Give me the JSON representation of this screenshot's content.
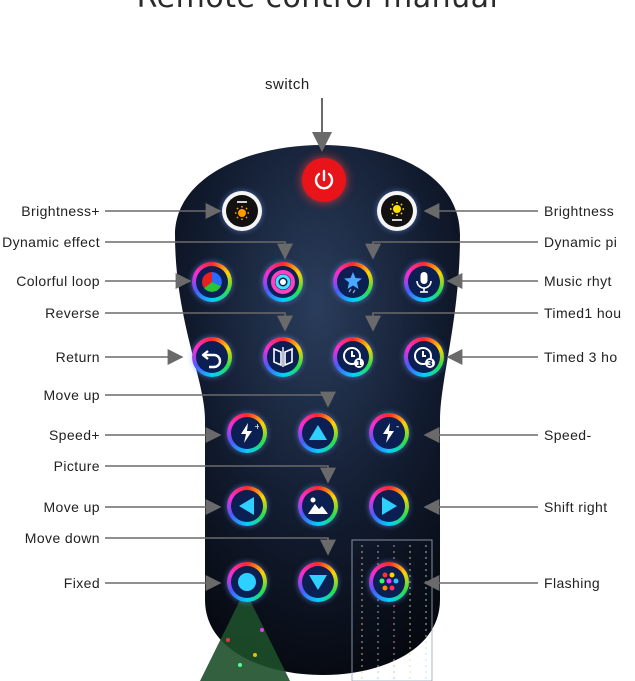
{
  "title": "Remote control manual",
  "switch_label": "switch",
  "left_labels": [
    "Brightness+",
    "Dynamic effect",
    "Colorful loop",
    "Reverse",
    "Return",
    "Move up",
    "Speed+",
    "Picture",
    "Move up",
    "Move down",
    "Fixed"
  ],
  "right_labels": [
    "Brightness",
    "Dynamic pi",
    "Music rhyt",
    "Timed1 hou",
    "Timed 3 ho",
    "Speed-",
    "Shift right",
    "Flashing"
  ],
  "buttons": [
    "power-icon",
    "brightness-up-icon",
    "brightness-down-icon",
    "colorful-loop-icon",
    "dynamic-effect-icon",
    "dynamic-picture-icon",
    "music-rhythm-icon",
    "return-icon",
    "reverse-icon",
    "timer-1h-icon",
    "timer-3h-icon",
    "speed-up-icon",
    "move-up-icon",
    "speed-down-icon",
    "move-left-icon",
    "picture-icon",
    "shift-right-icon",
    "fixed-icon",
    "move-down-icon",
    "flashing-icon"
  ],
  "colors": {
    "remote_body": "#0b1222",
    "power_button": "#e8141a",
    "button_fill": "#0b1f52",
    "arrow": "#6a6a6a"
  }
}
